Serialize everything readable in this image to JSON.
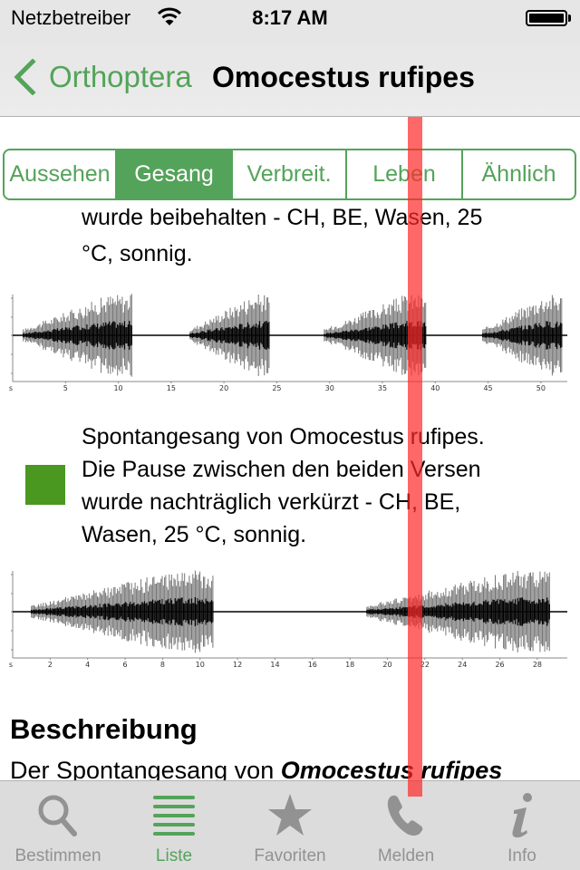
{
  "status_bar": {
    "carrier": "Netzbetreiber",
    "time": "8:17 AM",
    "battery_level": 1.0
  },
  "nav": {
    "back_label": "Orthoptera",
    "title": "Omocestus rufipes"
  },
  "segments": {
    "items": [
      "Aussehen",
      "Gesang",
      "Verbreit.",
      "Leben",
      "Ähnlich"
    ],
    "selected": "Gesang"
  },
  "recordings": [
    {
      "caption_visible_tail": [
        "wurde beibehalten - CH, BE, Wasen, 25",
        "°C, sonnig."
      ],
      "waveform": {
        "x_unit": "s",
        "x_ticks": [
          "5",
          "10",
          "15",
          "20",
          "25",
          "30",
          "35",
          "40",
          "45",
          "50"
        ],
        "xlim": [
          0,
          52.5
        ],
        "verses": [
          [
            1,
            11.3
          ],
          [
            16.8,
            24.3
          ],
          [
            29.5,
            39.2
          ],
          [
            44.5,
            52
          ]
        ]
      }
    },
    {
      "caption": [
        "Spontangesang von Omocestus rufipes.",
        "Die Pause zwischen den beiden Versen",
        "wurde nachträglich verkürzt - CH, BE,",
        "Wasen, 25 °C, sonnig."
      ],
      "play_color": "#4a981f",
      "waveform": {
        "x_unit": "s",
        "x_ticks": [
          "2",
          "4",
          "6",
          "8",
          "10",
          "12",
          "14",
          "16",
          "18",
          "20",
          "22",
          "24",
          "26",
          "28"
        ],
        "xlim": [
          0,
          29.6
        ],
        "verses": [
          [
            1,
            10.7
          ],
          [
            18.9,
            28.7
          ]
        ]
      }
    }
  ],
  "description": {
    "heading": "Beschreibung",
    "text_start": "Der Spontangesang von ",
    "species_italic": "Omocestus rufipes"
  },
  "tab_bar": {
    "items": [
      {
        "label": "Bestimmen",
        "icon": "search-icon"
      },
      {
        "label": "Liste",
        "icon": "list-icon"
      },
      {
        "label": "Favoriten",
        "icon": "star-icon"
      },
      {
        "label": "Melden",
        "icon": "phone-icon"
      },
      {
        "label": "Info",
        "icon": "info-icon"
      }
    ],
    "selected": "Liste"
  },
  "colors": {
    "accent": "#54a35a",
    "inactive_tab": "#929292",
    "overlay_marker": "#ff2828"
  }
}
